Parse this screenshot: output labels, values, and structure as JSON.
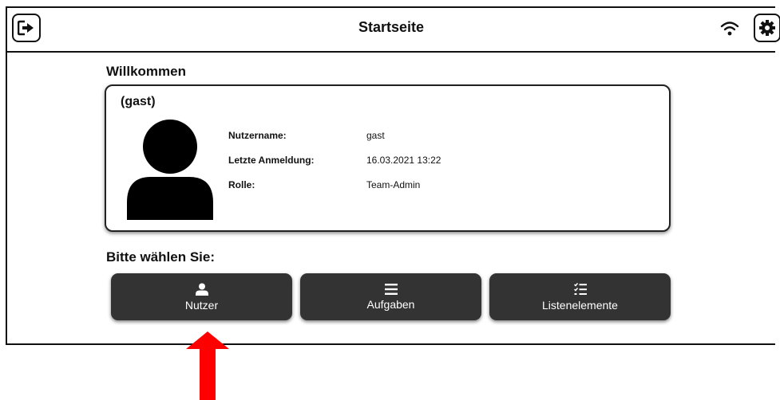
{
  "header": {
    "title": "Startseite",
    "logout_icon": "logout-icon",
    "wifi_icon": "wifi-icon",
    "settings_icon": "gear-icon"
  },
  "welcome": "Willkommen",
  "profile": {
    "display_name": "(gast)",
    "fields": [
      {
        "label": "Nutzername:",
        "value": "gast"
      },
      {
        "label": "Letzte Anmeldung:",
        "value": "16.03.2021 13:22"
      },
      {
        "label": "Rolle:",
        "value": "Team-Admin"
      }
    ]
  },
  "choose_prompt": "Bitte wählen Sie:",
  "nav_buttons": [
    {
      "label": "Nutzer",
      "icon": "user-icon"
    },
    {
      "label": "Aufgaben",
      "icon": "menu-lines-icon"
    },
    {
      "label": "Listenelemente",
      "icon": "checklist-icon"
    }
  ],
  "colors": {
    "button_bg": "#333333",
    "annotation_arrow": "#ff0000"
  }
}
